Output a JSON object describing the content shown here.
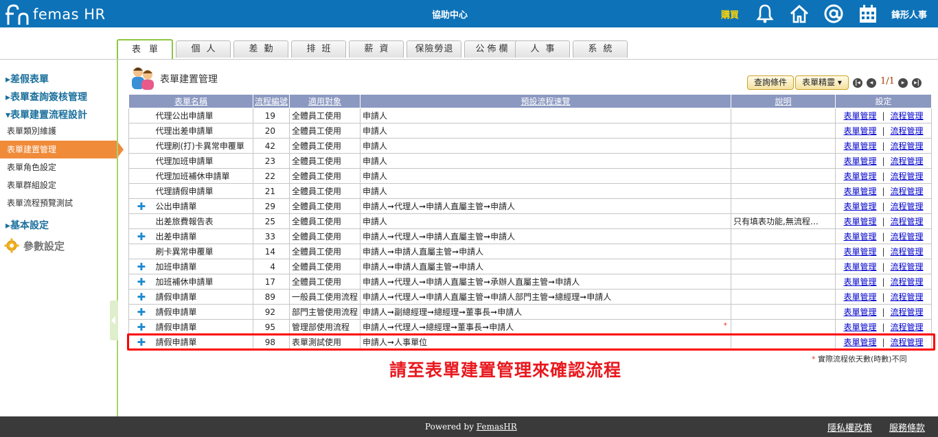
{
  "header": {
    "logo_text": "femas HR",
    "center_title": "協助中心",
    "buy_label": "購買",
    "company": "鋒形人事"
  },
  "tabs": [
    "表單",
    "個人",
    "差勤",
    "排班",
    "薪資",
    "保險勞退",
    "公佈欄",
    "人事",
    "系統"
  ],
  "sidebar": {
    "section1": "▸差假表單",
    "section2": "▸表單查詢簽核管理",
    "section3": "▾表單建置流程設計",
    "items": [
      "表單類別維護",
      "表單建置管理",
      "表單角色設定",
      "表單群組設定",
      "表單流程預覽測試"
    ],
    "section4": "▸基本設定",
    "section5": "參數設定"
  },
  "main": {
    "title": "表單建置管理",
    "query_button": "查詢條件",
    "wizard_button": "表單精靈 ▾",
    "page_info": "1/1",
    "columns": [
      "表單名稱",
      "流程編號",
      "適用對象",
      "預設流程速覽",
      "說明",
      "設定"
    ],
    "rows": [
      {
        "plus": "",
        "name": "代理公出申請單",
        "num": "19",
        "target": "全體員工使用",
        "flow": "申請人",
        "desc": ""
      },
      {
        "plus": "",
        "name": "代理出差申請單",
        "num": "20",
        "target": "全體員工使用",
        "flow": "申請人",
        "desc": ""
      },
      {
        "plus": "",
        "name": "代理刷(打)卡異常申覆單",
        "num": "42",
        "target": "全體員工使用",
        "flow": "申請人",
        "desc": ""
      },
      {
        "plus": "",
        "name": "代理加班申請單",
        "num": "23",
        "target": "全體員工使用",
        "flow": "申請人",
        "desc": ""
      },
      {
        "plus": "",
        "name": "代理加班補休申請單",
        "num": "22",
        "target": "全體員工使用",
        "flow": "申請人",
        "desc": ""
      },
      {
        "plus": "",
        "name": "代理請假申請單",
        "num": "21",
        "target": "全體員工使用",
        "flow": "申請人",
        "desc": ""
      },
      {
        "plus": "✚",
        "name": "公出申請單",
        "num": "29",
        "target": "全體員工使用",
        "flow": "申請人➞代理人➞申請人直屬主管➞申請人",
        "desc": ""
      },
      {
        "plus": "",
        "name": "出差旅費報告表",
        "num": "25",
        "target": "全體員工使用",
        "flow": "申請人",
        "desc": "只有填表功能,無流程…"
      },
      {
        "plus": "✚",
        "name": "出差申請單",
        "num": "33",
        "target": "全體員工使用",
        "flow": "申請人➞代理人➞申請人直屬主管➞申請人",
        "desc": ""
      },
      {
        "plus": "",
        "name": "刷卡異常申覆單",
        "num": "14",
        "target": "全體員工使用",
        "flow": "申請人➞申請人直屬主管➞申請人",
        "desc": ""
      },
      {
        "plus": "✚",
        "name": "加班申請單",
        "num": "4",
        "target": "全體員工使用",
        "flow": "申請人➞申請人直屬主管➞申請人",
        "desc": ""
      },
      {
        "plus": "✚",
        "name": "加班補休申請單",
        "num": "17",
        "target": "全體員工使用",
        "flow": "申請人➞代理人➞申請人直屬主管➞承辦人直屬主管➞申請人",
        "desc": ""
      },
      {
        "plus": "✚",
        "name": "請假申請單",
        "num": "89",
        "target": "一般員工使用流程",
        "flow": "申請人➞代理人➞申請人直屬主管➞申請人部門主管➞總經理➞申請人",
        "desc": ""
      },
      {
        "plus": "✚",
        "name": "請假申請單",
        "num": "92",
        "target": "部門主管使用流程",
        "flow": "申請人➞副總經理➞總經理➞董事長➞申請人",
        "desc": ""
      },
      {
        "plus": "✚",
        "name": "請假申請單",
        "num": "95",
        "target": "管理部使用流程",
        "flow": "申請人➞代理人➞總經理➞董事長➞申請人",
        "desc": "",
        "star": "*"
      },
      {
        "plus": "✚",
        "name": "請假申請單",
        "num": "98",
        "target": "表單測試使用",
        "flow": "申請人➞人事單位",
        "desc": ""
      }
    ],
    "set_link1": "表單管理",
    "set_sep": "|",
    "set_link2": "流程管理",
    "footnote_star": "*",
    "footnote": "實際流程依天數(時數)不同",
    "notice": "請至表單建置管理來確認流程"
  },
  "footer": {
    "powered_prefix": "Powered by ",
    "powered_link": "FemasHR",
    "privacy": "隱私權政策",
    "terms": "服務條款"
  },
  "colors": {
    "header_bg": "#0d72b8",
    "accent_green": "#8dc63f",
    "active_sidebar": "#f08b3a",
    "table_header": "#8b98c0",
    "notice_red": "#e8191f"
  },
  "icons": [
    "bell-icon",
    "home-icon",
    "at-icon",
    "calendar-icon",
    "gear-icon",
    "people-icon"
  ]
}
